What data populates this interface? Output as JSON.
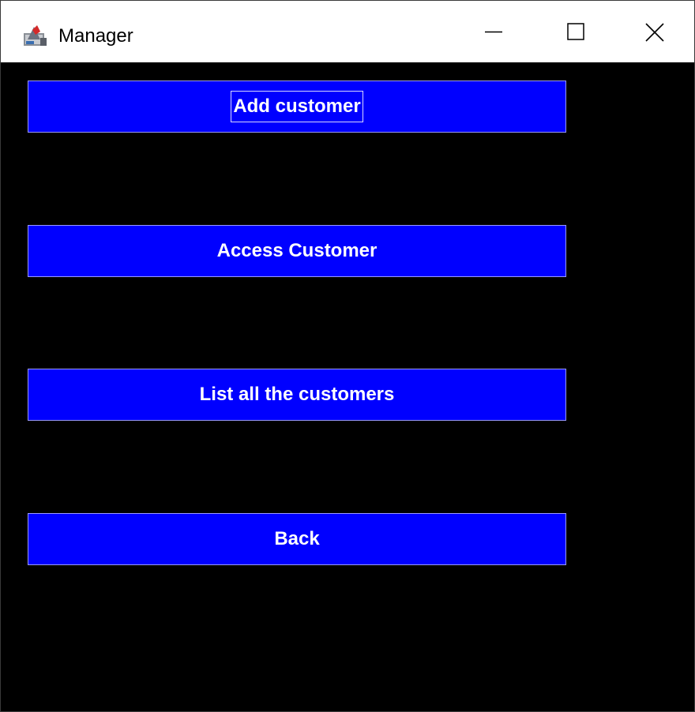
{
  "window": {
    "title": "Manager",
    "app_icon": "java-app-icon",
    "controls": {
      "minimize_icon": "minimize-icon",
      "maximize_icon": "maximize-icon",
      "close_icon": "close-icon"
    }
  },
  "menu": {
    "buttons": [
      {
        "label": "Add customer",
        "focused": true
      },
      {
        "label": "Access Customer",
        "focused": false
      },
      {
        "label": "List all the customers",
        "focused": false
      },
      {
        "label": "Back",
        "focused": false
      }
    ]
  },
  "colors": {
    "background": "#000000",
    "button_fill": "#0000ff",
    "button_text": "#ffffff",
    "titlebar": "#ffffff"
  }
}
